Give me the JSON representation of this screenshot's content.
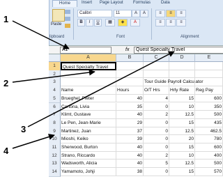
{
  "ribbon": {
    "tabs": [
      "Home",
      "Insert",
      "Page Layout",
      "Formulas",
      "Data"
    ],
    "font_name": "Calibri",
    "font_size": "11",
    "paste_label": "Paste",
    "bold": "B",
    "italic": "I",
    "underline": "U",
    "clipboard_label": "lipboard",
    "font_group_label": "Font",
    "alignment_label": "Alignment"
  },
  "formula_bar": {
    "name_box": "A1",
    "fx": "fx",
    "formula": "Quest Specialty Travel"
  },
  "columns": [
    "A",
    "B",
    "C",
    "D",
    "E"
  ],
  "title_cell": "Quest Specialty Travel",
  "subtitle_cell": "Tour Guide Payroll Calculator",
  "headers": [
    "Name",
    "Hours",
    "O/T Hrs",
    "Hrly Rate",
    "Reg Pay"
  ],
  "rows": [
    [
      "Brueghel, Pieter",
      "40",
      "4",
      "15",
      "600"
    ],
    [
      "Cortona, Livia",
      "35",
      "0",
      "10",
      "350"
    ],
    [
      "Klimt, Gustave",
      "40",
      "2",
      "12.5",
      "500"
    ],
    [
      "Le Pen, Jean-Marie",
      "29",
      "0",
      "15",
      "435"
    ],
    [
      "Martinez, Juan",
      "37",
      "0",
      "12.5",
      "462.5"
    ],
    [
      "Mioshi, Keiko",
      "39",
      "0",
      "20",
      "780"
    ],
    [
      "Sherwood, Burton",
      "40",
      "0",
      "15",
      "600"
    ],
    [
      "Strano, Riccardo",
      "40",
      "2",
      "10",
      "400"
    ],
    [
      "Wadsworth, Alicia",
      "40",
      "5",
      "12.5",
      "500"
    ],
    [
      "Yamamoto, Johji",
      "38",
      "0",
      "15",
      "570"
    ]
  ],
  "row_numbers": [
    "1",
    "2",
    "3",
    "4",
    "5",
    "6",
    "7",
    "8",
    "9",
    "10",
    "11",
    "12",
    "13",
    "14"
  ],
  "callouts": [
    "1",
    "2",
    "3",
    "4"
  ]
}
